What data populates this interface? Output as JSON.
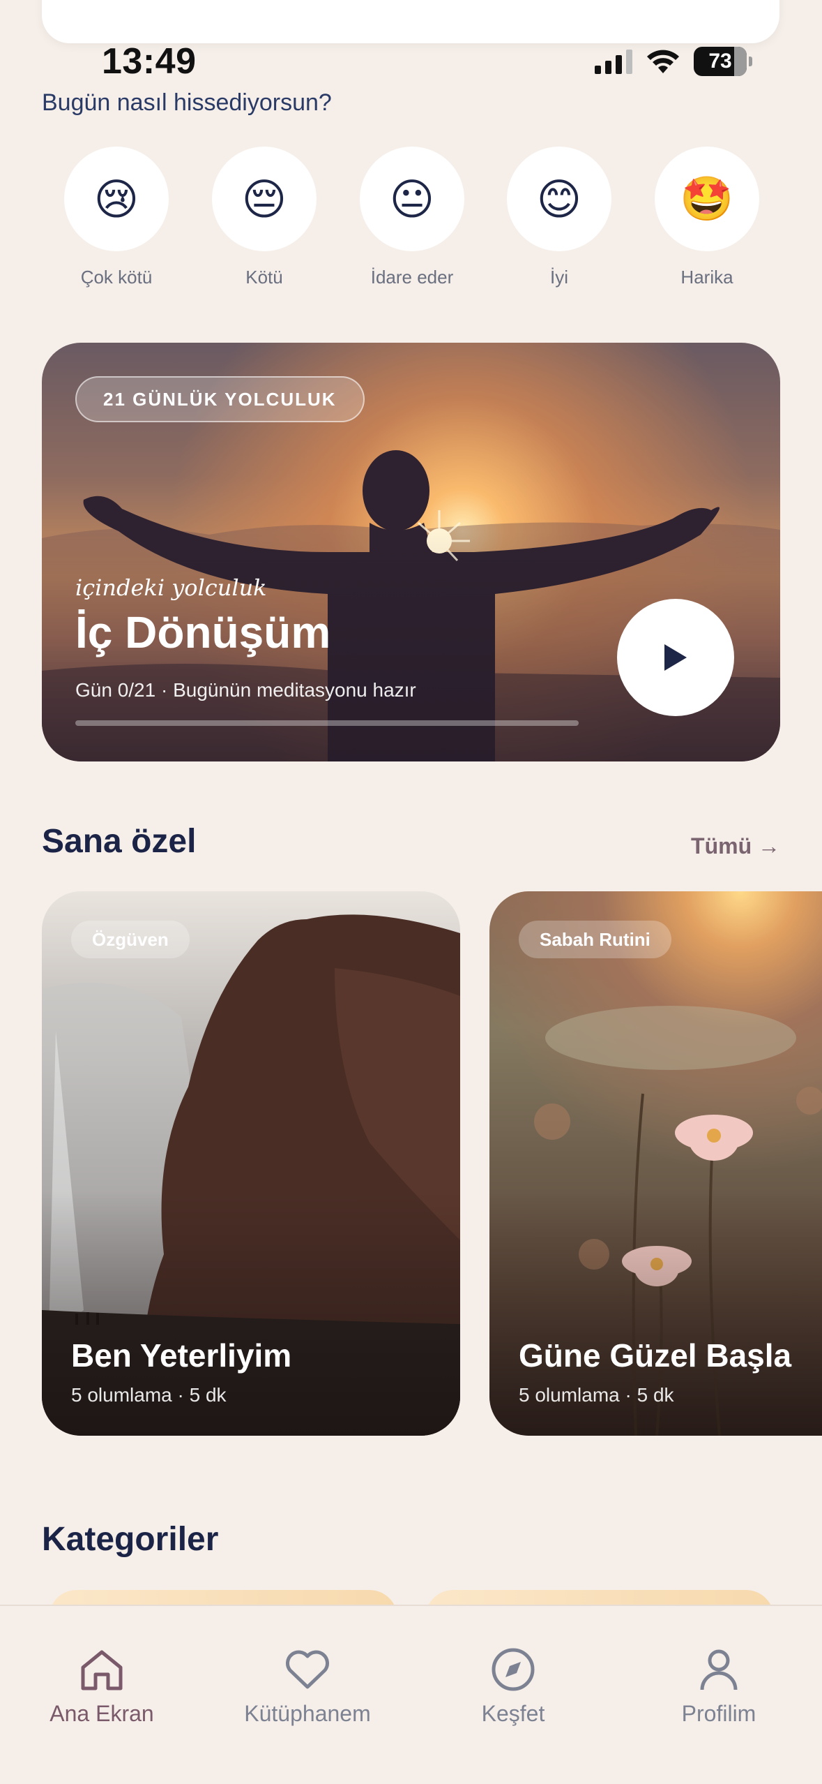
{
  "status_bar": {
    "time": "13:49",
    "battery": "73"
  },
  "mood": {
    "question": "Bugün nasıl hissediyorsun?",
    "options": [
      {
        "emoji": "😢",
        "label": "Çok kötü"
      },
      {
        "emoji": "😔",
        "label": "Kötü"
      },
      {
        "emoji": "😐",
        "label": "İdare eder"
      },
      {
        "emoji": "😊",
        "label": "İyi"
      },
      {
        "emoji": "🤩",
        "label": "Harika"
      }
    ]
  },
  "journey": {
    "badge": "21 GÜNLÜK YOLCULUK",
    "kicker": "içindeki yolculuk",
    "title": "İç Dönüşüm",
    "subtitle": "Gün 0/21 · Bugünün meditasyonu hazır",
    "progress": 0,
    "play_icon": "play-icon"
  },
  "for_you": {
    "title": "Sana özel",
    "see_all": "Tümü →",
    "cards": [
      {
        "chip": "Özgüven",
        "title": "Ben Yeterliyim",
        "meta": "5 olumlama · 5 dk"
      },
      {
        "chip": "Sabah Rutini",
        "title": "Güne Güzel Başla",
        "meta": "5 olumlama · 5 dk"
      }
    ]
  },
  "categories": {
    "title": "Kategoriler"
  },
  "tab_bar": {
    "tabs": [
      {
        "label": "Ana Ekran",
        "icon": "home-icon",
        "active": true
      },
      {
        "label": "Kütüphanem",
        "icon": "heart-icon",
        "active": false
      },
      {
        "label": "Keşfet",
        "icon": "compass-icon",
        "active": false
      },
      {
        "label": "Profilim",
        "icon": "person-icon",
        "active": false
      }
    ],
    "active_color": "#7a5a6a",
    "inactive_color": "#7d8293"
  }
}
